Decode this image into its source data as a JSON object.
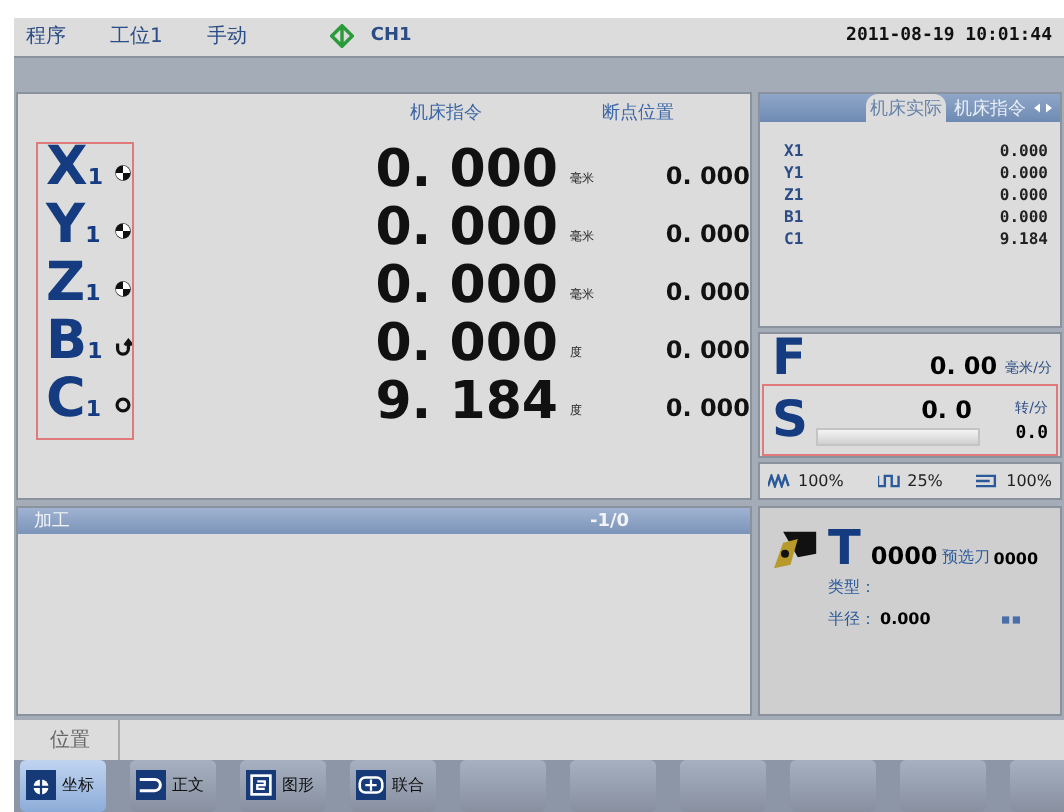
{
  "status_bar": {
    "program": "程序",
    "station": "工位1",
    "mode": "手动",
    "channel": "CH1",
    "datetime": "2011-08-19 10:01:44"
  },
  "position": {
    "headers": [
      "机床指令",
      "断点位置"
    ],
    "axes": [
      {
        "name": "X",
        "index": "1",
        "kind": "linear",
        "value": "0. 000",
        "unit": "毫米",
        "breakpoint": "0. 000"
      },
      {
        "name": "Y",
        "index": "1",
        "kind": "linear",
        "value": "0. 000",
        "unit": "毫米",
        "breakpoint": "0. 000"
      },
      {
        "name": "Z",
        "index": "1",
        "kind": "linear",
        "value": "0. 000",
        "unit": "毫米",
        "breakpoint": "0. 000"
      },
      {
        "name": "B",
        "index": "1",
        "kind": "rotary",
        "value": "0. 000",
        "unit": "度",
        "breakpoint": "0. 000"
      },
      {
        "name": "C",
        "index": "1",
        "kind": "spindle",
        "value": "9. 184",
        "unit": "度",
        "breakpoint": "0. 000"
      }
    ]
  },
  "machine_panel": {
    "tabs": [
      {
        "label": "机床实际",
        "selected": true
      },
      {
        "label": "机床指令",
        "selected": false
      }
    ],
    "rows": [
      {
        "axis": "X1",
        "value": "0.000"
      },
      {
        "axis": "Y1",
        "value": "0.000"
      },
      {
        "axis": "Z1",
        "value": "0.000"
      },
      {
        "axis": "B1",
        "value": "0.000"
      },
      {
        "axis": "C1",
        "value": "9.184"
      }
    ]
  },
  "feed": {
    "label": "F",
    "value": "0. 00",
    "unit": "毫米/分"
  },
  "spindle": {
    "label": "S",
    "value": "0. 0",
    "unit": "转/分",
    "reading": "0.0",
    "level": 0
  },
  "overrides": [
    {
      "kind": "feed",
      "value": "100%"
    },
    {
      "kind": "rapid",
      "value": "25%"
    },
    {
      "kind": "spindle",
      "value": "100%"
    }
  ],
  "program": {
    "title": "加工",
    "counter": "-1/0"
  },
  "tool": {
    "label": "T",
    "number": "0000",
    "preselect_label": "预选刀",
    "preselect": "0000",
    "type_label": "类型：",
    "radius_label": "半径：",
    "radius": "0.000"
  },
  "bottom_tab": "位置",
  "softkeys": [
    {
      "kind": "coordinates",
      "label": "坐标",
      "selected": true
    },
    {
      "kind": "text",
      "label": "正文",
      "selected": false
    },
    {
      "kind": "graphics",
      "label": "图形",
      "selected": false
    },
    {
      "kind": "combined",
      "label": "联合",
      "selected": false
    },
    {
      "kind": "blank",
      "selected": false
    },
    {
      "kind": "blank",
      "selected": false
    },
    {
      "kind": "blank",
      "selected": false
    },
    {
      "kind": "blank",
      "selected": false
    },
    {
      "kind": "blank",
      "selected": false
    },
    {
      "kind": "blank",
      "selected": false
    }
  ]
}
